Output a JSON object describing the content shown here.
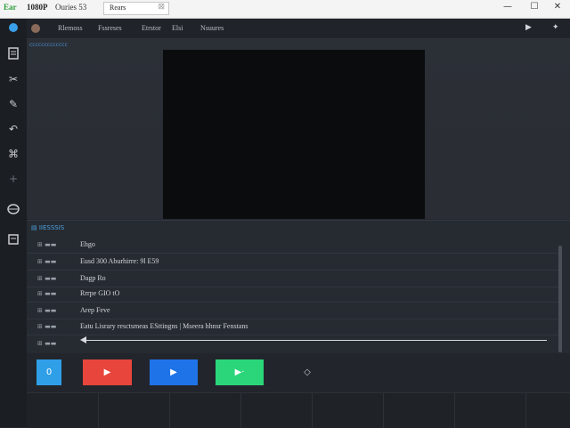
{
  "titlebar": {
    "logo": "Ear",
    "title": "1080P",
    "subtitle": "Ouries 53",
    "tab_label": "Rears",
    "tab_close": "⊠",
    "minimize": "—",
    "maximize": "☐",
    "close": "✕"
  },
  "leftbar": {
    "icons": [
      "camera-icon",
      "document-icon",
      "scissors-icon",
      "edit-icon",
      "undo-icon",
      "crop-icon",
      "plus-icon",
      "disc-icon",
      "grid-icon"
    ]
  },
  "menu": {
    "items": [
      "Rlemoss",
      "Fssreses",
      "Etrstor",
      "Elsi",
      "Nsuures"
    ],
    "right_icons": [
      "play-icon",
      "pin-icon"
    ]
  },
  "preview": {
    "label": "ccccccccccccc"
  },
  "panel": {
    "title": "▤ IIESSSIS",
    "rows": [
      {
        "icon": "⊞ ▬▬",
        "text": "Ehgo"
      },
      {
        "icon": "⊞ ▬▬",
        "text": "Eusd  300   Aburhirre:  9l E59"
      },
      {
        "icon": "⊞ ▬▬",
        "text": "Dagp  Ro"
      },
      {
        "icon": "⊞ ▬▬",
        "text": "Rrrpe  GIO  tO"
      },
      {
        "icon": "⊞ ▬▬",
        "text": "Arep  Feve"
      },
      {
        "icon": "⊞ ▬▬",
        "text": "Eatu   Lisrary  resctsmeas    ESttingns    |   Mseera  hhnsr  Fenstans"
      },
      {
        "icon": "⊞ ▬▬",
        "text": ""
      }
    ]
  },
  "buttons": {
    "b1": "0",
    "b2": "▶",
    "b3": "▶",
    "b4": "▶·",
    "b5": "◇"
  }
}
